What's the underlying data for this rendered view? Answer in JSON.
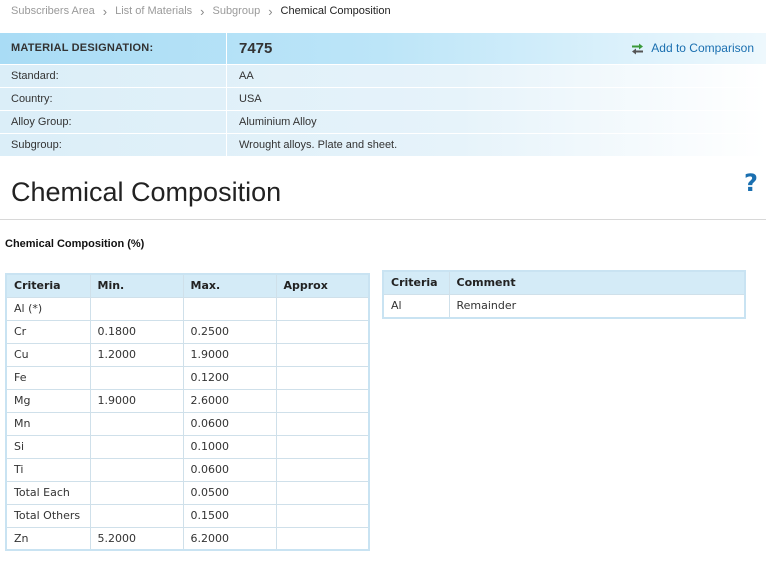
{
  "breadcrumb": [
    "Subscribers Area",
    "List of Materials",
    "Subgroup"
  ],
  "breadcrumb_current": "Chemical Composition",
  "material": {
    "label": "MATERIAL DESIGNATION:",
    "value": "7475",
    "compare_label": "Add to Comparison",
    "rows": [
      {
        "label": "Standard:",
        "value": "AA"
      },
      {
        "label": "Country:",
        "value": "USA"
      },
      {
        "label": "Alloy Group:",
        "value": "Aluminium Alloy"
      },
      {
        "label": "Subgroup:",
        "value": "Wrought alloys. Plate and sheet."
      }
    ]
  },
  "page_title": "Chemical Composition",
  "help_label": "?",
  "section_heading": "Chemical Composition (%)",
  "composition": {
    "columns": [
      "Criteria",
      "Min.",
      "Max.",
      "Approx"
    ],
    "rows": [
      [
        "Al (*)",
        "",
        "",
        ""
      ],
      [
        "Cr",
        "0.1800",
        "0.2500",
        ""
      ],
      [
        "Cu",
        "1.2000",
        "1.9000",
        ""
      ],
      [
        "Fe",
        "",
        "0.1200",
        ""
      ],
      [
        "Mg",
        "1.9000",
        "2.6000",
        ""
      ],
      [
        "Mn",
        "",
        "0.0600",
        ""
      ],
      [
        "Si",
        "",
        "0.1000",
        ""
      ],
      [
        "Ti",
        "",
        "0.0600",
        ""
      ],
      [
        "Total Each",
        "",
        "0.0500",
        ""
      ],
      [
        "Total Others",
        "",
        "0.1500",
        ""
      ],
      [
        "Zn",
        "5.2000",
        "6.2000",
        ""
      ]
    ]
  },
  "comments": {
    "columns": [
      "Criteria",
      "Comment"
    ],
    "rows": [
      [
        "Al",
        "Remainder"
      ]
    ]
  },
  "colors": {
    "link": "#1a6fb0",
    "header_band": "#a9dcf5",
    "row_band": "#dbeef8",
    "table_header": "#d4ebf7"
  },
  "icons": {
    "breadcrumb_separator": "chevron-right-icon",
    "compare": "swap-arrows-icon",
    "help": "question-mark-icon"
  }
}
